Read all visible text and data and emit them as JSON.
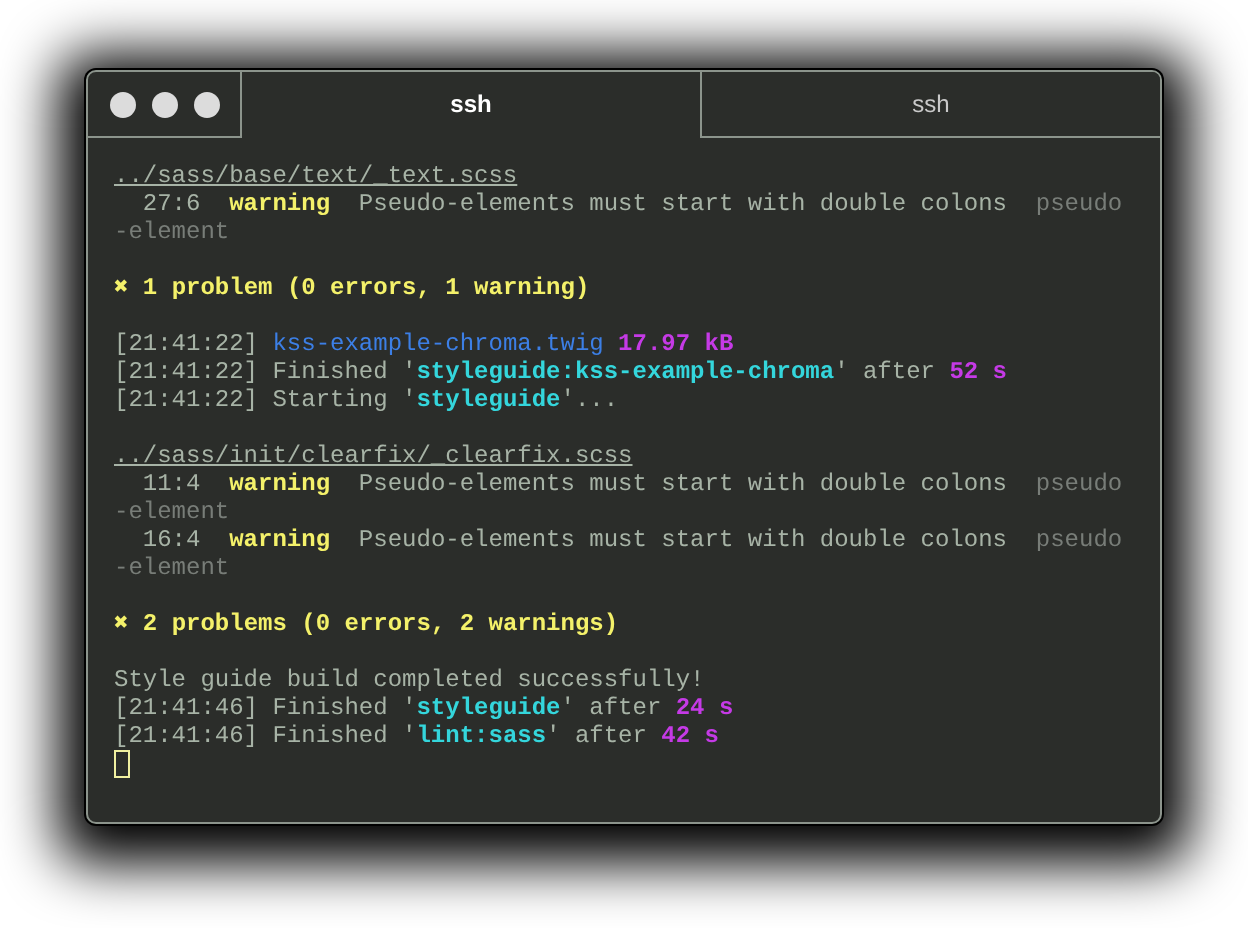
{
  "window": {
    "tabs": [
      {
        "label": "ssh",
        "selected": true
      },
      {
        "label": "ssh",
        "selected": false
      }
    ]
  },
  "terminal": {
    "cursor": true,
    "blocks": [
      [
        [
          {
            "kind": "path",
            "text": "../sass/base/text/_text.scss"
          }
        ],
        [
          {
            "kind": "plain",
            "text": "  27:6  "
          },
          {
            "kind": "warn",
            "text": "warning"
          },
          {
            "kind": "plain",
            "text": "  Pseudo-elements must start with double colons  "
          },
          {
            "kind": "dim",
            "text": "pseudo"
          }
        ],
        [
          {
            "kind": "dim",
            "text": "-element"
          }
        ]
      ],
      [
        [
          {
            "kind": "warn",
            "text": "✖ 1 problem (0 errors, 1 warning)"
          }
        ]
      ],
      [
        [
          {
            "kind": "plain",
            "text": "[21:41:22] "
          },
          {
            "kind": "blue",
            "text": "kss-example-chroma.twig "
          },
          {
            "kind": "magenta",
            "text": "17.97 kB"
          }
        ],
        [
          {
            "kind": "plain",
            "text": "[21:41:22] Finished '"
          },
          {
            "kind": "cyan",
            "text": "styleguide:kss-example-chroma"
          },
          {
            "kind": "plain",
            "text": "' after "
          },
          {
            "kind": "magenta",
            "text": "52 s"
          }
        ],
        [
          {
            "kind": "plain",
            "text": "[21:41:22] Starting '"
          },
          {
            "kind": "cyan",
            "text": "styleguide"
          },
          {
            "kind": "plain",
            "text": "'..."
          }
        ]
      ],
      [
        [
          {
            "kind": "path",
            "text": "../sass/init/clearfix/_clearfix.scss"
          }
        ],
        [
          {
            "kind": "plain",
            "text": "  11:4  "
          },
          {
            "kind": "warn",
            "text": "warning"
          },
          {
            "kind": "plain",
            "text": "  Pseudo-elements must start with double colons  "
          },
          {
            "kind": "dim",
            "text": "pseudo"
          }
        ],
        [
          {
            "kind": "dim",
            "text": "-element"
          }
        ],
        [
          {
            "kind": "plain",
            "text": "  16:4  "
          },
          {
            "kind": "warn",
            "text": "warning"
          },
          {
            "kind": "plain",
            "text": "  Pseudo-elements must start with double colons  "
          },
          {
            "kind": "dim",
            "text": "pseudo"
          }
        ],
        [
          {
            "kind": "dim",
            "text": "-element"
          }
        ]
      ],
      [
        [
          {
            "kind": "warn",
            "text": "✖ 2 problems (0 errors, 2 warnings)"
          }
        ]
      ],
      [
        [
          {
            "kind": "plain",
            "text": "Style guide build completed successfully!"
          }
        ],
        [
          {
            "kind": "plain",
            "text": "[21:41:46] Finished '"
          },
          {
            "kind": "cyan",
            "text": "styleguide"
          },
          {
            "kind": "plain",
            "text": "' after "
          },
          {
            "kind": "magenta",
            "text": "24 s"
          }
        ],
        [
          {
            "kind": "plain",
            "text": "[21:41:46] Finished '"
          },
          {
            "kind": "cyan",
            "text": "lint:sass"
          },
          {
            "kind": "plain",
            "text": "' after "
          },
          {
            "kind": "magenta",
            "text": "42 s"
          }
        ]
      ]
    ]
  }
}
